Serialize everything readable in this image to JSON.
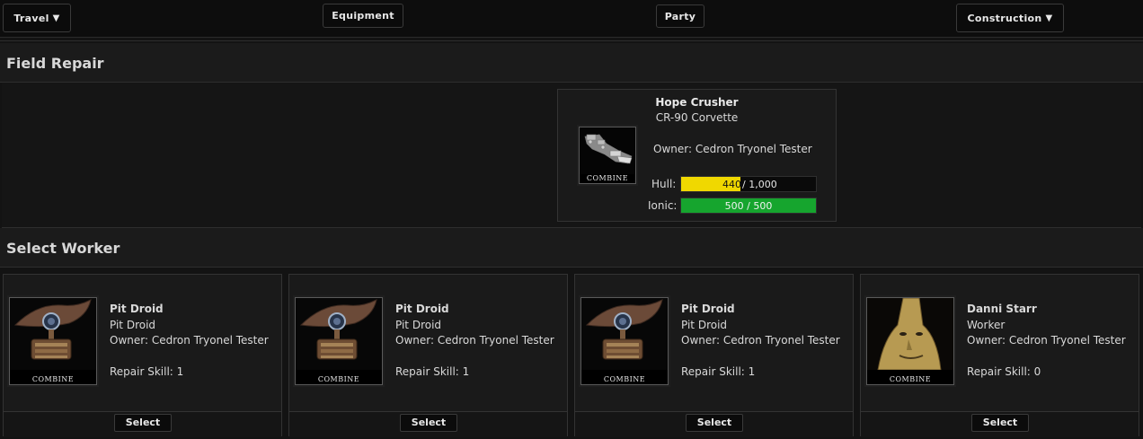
{
  "nav": {
    "travel": "Travel",
    "equipment": "Equipment",
    "party": "Party",
    "construction": "Construction",
    "caret": "▼"
  },
  "sections": {
    "field_repair": "Field Repair",
    "select_worker": "Select Worker"
  },
  "ship": {
    "name": "Hope Crusher",
    "type": "CR-90 Corvette",
    "owner": "Owner: Cedron Tryonel Tester",
    "image_badge": "COMBINE",
    "hull": {
      "label": "Hull:",
      "value_text": "440",
      "max_text": "/ 1,000",
      "fraction": 0.44,
      "color": "#f0d800"
    },
    "ionic": {
      "label": "Ionic:",
      "text": "500 / 500",
      "fraction": 1.0,
      "color": "#16a52e"
    }
  },
  "workers": [
    {
      "name": "Pit Droid",
      "type": "Pit Droid",
      "owner": "Owner: Cedron Tryonel Tester",
      "skill": "Repair Skill: 1",
      "badge": "COMBINE",
      "select": "Select",
      "portrait": "pit-droid"
    },
    {
      "name": "Pit Droid",
      "type": "Pit Droid",
      "owner": "Owner: Cedron Tryonel Tester",
      "skill": "Repair Skill: 1",
      "badge": "COMBINE",
      "select": "Select",
      "portrait": "pit-droid"
    },
    {
      "name": "Pit Droid",
      "type": "Pit Droid",
      "owner": "Owner: Cedron Tryonel Tester",
      "skill": "Repair Skill: 1",
      "badge": "COMBINE",
      "select": "Select",
      "portrait": "pit-droid"
    },
    {
      "name": "Danni Starr",
      "type": "Worker",
      "owner": "Owner: Cedron Tryonel Tester",
      "skill": "Repair Skill: 0",
      "badge": "COMBINE",
      "select": "Select",
      "portrait": "alien-worker"
    }
  ]
}
